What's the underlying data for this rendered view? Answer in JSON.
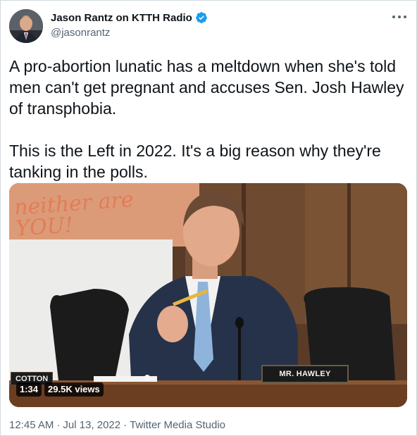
{
  "author": {
    "display_name": "Jason Rantz on KTTH Radio",
    "handle": "@jasonrantz",
    "verified": true,
    "verified_color": "#1d9bf0"
  },
  "more_icon": "more-horizontal-icon",
  "tweet": {
    "text": "A pro-abortion lunatic has a meltdown when she's told men can't get pregnant and accuses Sen. Josh Hawley of transphobia.\n\nThis is the Left in 2022. It's a big reason why they're tanking in the polls."
  },
  "media": {
    "type": "video",
    "duration": "1:34",
    "views": "29.5K views",
    "nameplate_left": "COTTON",
    "nameplate_right": "MR. HAWLEY",
    "sign_text": "neither are YOU!"
  },
  "meta": {
    "time": "12:45 AM",
    "separator": "·",
    "date": "Jul 13, 2022",
    "source": "Twitter Media Studio"
  }
}
